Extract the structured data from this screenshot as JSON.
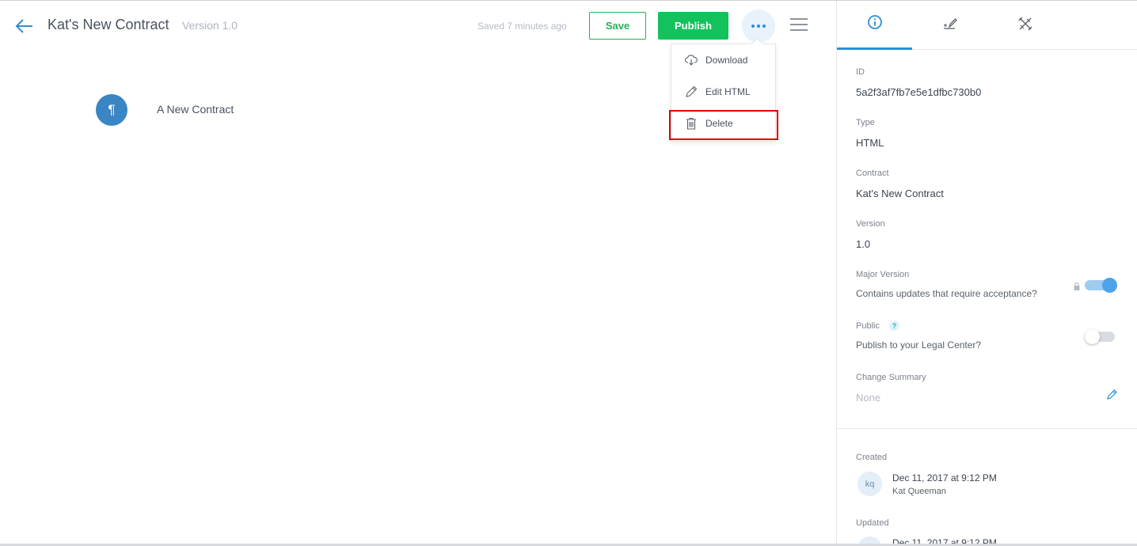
{
  "header": {
    "title": "Kat's New Contract",
    "version": "Version 1.0",
    "saved_status": "Saved 7 minutes ago",
    "save_label": "Save",
    "publish_label": "Publish"
  },
  "menu": {
    "items": [
      {
        "label": "Download",
        "icon": "cloud-download-icon"
      },
      {
        "label": "Edit HTML",
        "icon": "pencil-icon"
      },
      {
        "label": "Delete",
        "icon": "trash-icon"
      }
    ]
  },
  "document": {
    "block_icon": "¶",
    "block_title": "A New Contract"
  },
  "panel": {
    "tabs": [
      {
        "icon": "info-icon",
        "active": true
      },
      {
        "icon": "signature-icon",
        "active": false
      },
      {
        "icon": "tools-icon",
        "active": false
      }
    ],
    "id_label": "ID",
    "id_value": "5a2f3af7fb7e5e1dfbc730b0",
    "type_label": "Type",
    "type_value": "HTML",
    "contract_label": "Contract",
    "contract_value": "Kat's New Contract",
    "version_label": "Version",
    "version_value": "1.0",
    "major_label": "Major Version",
    "major_desc": "Contains updates that require acceptance?",
    "major_on": true,
    "public_label": "Public",
    "public_help": "?",
    "public_desc": "Publish to your Legal Center?",
    "public_on": false,
    "summary_label": "Change Summary",
    "summary_value": "None",
    "created_label": "Created",
    "created_date": "Dec 11, 2017 at 9:12 PM",
    "created_by": "Kat Queeman",
    "created_initials": "kq",
    "updated_label": "Updated",
    "updated_date": "Dec 11, 2017 at 9:12 PM"
  },
  "colors": {
    "accent": "#2b8fd6",
    "publish": "#13c25c",
    "save_border": "#20b35a",
    "highlight": "#e00000"
  }
}
